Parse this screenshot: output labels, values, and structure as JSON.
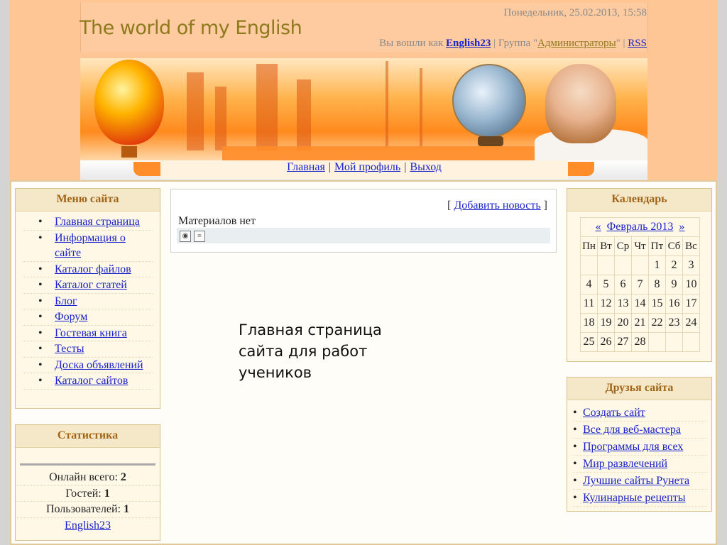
{
  "header": {
    "site_title": "The world of my English",
    "date": "Понедельник, 25.02.2013, 15:58",
    "logged_in_prefix": "Вы вошли как",
    "username": "English23",
    "group_prefix": "| Группа \"",
    "group_name": "Администраторы",
    "group_suffix": "\" |",
    "rss": "RSS"
  },
  "nav": {
    "items": [
      {
        "label": "Главная"
      },
      {
        "label": "Мой профиль"
      },
      {
        "label": "Выход"
      }
    ],
    "separator": "|"
  },
  "menu": {
    "title": "Меню сайта",
    "items": [
      {
        "label": "Главная страница"
      },
      {
        "label": "Информация о сайте"
      },
      {
        "label": "Каталог файлов"
      },
      {
        "label": "Каталог статей"
      },
      {
        "label": "Блог"
      },
      {
        "label": "Форум"
      },
      {
        "label": "Гостевая книга"
      },
      {
        "label": "Тесты"
      },
      {
        "label": "Доска объявлений"
      },
      {
        "label": "Каталог сайтов"
      }
    ]
  },
  "stats": {
    "title": "Статистика",
    "online_label": "Онлайн всего:",
    "online_value": "2",
    "guests_label": "Гостей:",
    "guests_value": "1",
    "users_label": "Пользователей:",
    "users_value": "1",
    "user_link": "English23"
  },
  "news": {
    "open_bracket": "[",
    "add_news": "Добавить новость",
    "close_bracket": "]",
    "empty_text": "Материалов нет"
  },
  "caption": {
    "line1": "Главная страница",
    "line2": "сайта для работ",
    "line3": "учеников"
  },
  "calendar": {
    "title": "Календарь",
    "prev": "«",
    "month": "Февраль 2013",
    "next": "»",
    "weekdays": [
      "Пн",
      "Вт",
      "Ср",
      "Чт",
      "Пт",
      "Сб",
      "Вс"
    ],
    "weeks": [
      [
        "",
        "",
        "",
        "",
        "1",
        "2",
        "3"
      ],
      [
        "4",
        "5",
        "6",
        "7",
        "8",
        "9",
        "10"
      ],
      [
        "11",
        "12",
        "13",
        "14",
        "15",
        "16",
        "17"
      ],
      [
        "18",
        "19",
        "20",
        "21",
        "22",
        "23",
        "24"
      ],
      [
        "25",
        "26",
        "27",
        "28",
        "",
        "",
        ""
      ]
    ]
  },
  "friends": {
    "title": "Друзья сайта",
    "items": [
      {
        "label": "Создать сайт"
      },
      {
        "label": "Все для веб-мастера"
      },
      {
        "label": "Программы для всех"
      },
      {
        "label": "Мир развлечений"
      },
      {
        "label": "Лучшие сайты Рунета"
      },
      {
        "label": "Кулинарные рецепты"
      }
    ]
  },
  "colors": {
    "header_bg": "#fdc694",
    "title_color": "#8c7a1c",
    "link_color": "#1a23c8",
    "block_title_color": "#a0651a",
    "block_bg": "#fff8e6"
  },
  "icons": {
    "view": "eye-icon",
    "print": "document-icon"
  }
}
